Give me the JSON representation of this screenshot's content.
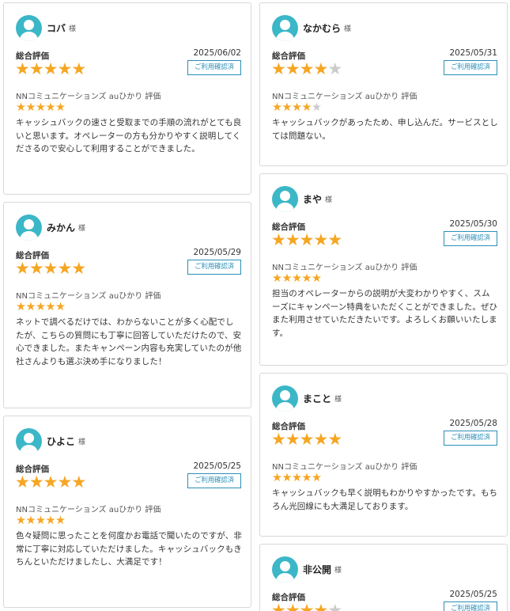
{
  "colors": {
    "star": "#f5a623",
    "star_empty": "#cccccc",
    "avatar": "#3bb7c7",
    "badge": "#2b8fb8"
  },
  "icons": {
    "star": "★",
    "avatar": "user-avatar-icon"
  },
  "labels": {
    "honorific": "様",
    "overall": "総合評価",
    "verified": "ご利用確認済",
    "service_rating": "NNコミュニケーションズ auひかり 評価"
  },
  "reviews": [
    {
      "name": "コバ",
      "date": "2025/06/02",
      "overall": 5,
      "service": 5,
      "comment": "キャッシュバックの速さと受取までの手順の流れがとても良いと思います。オペレーターの方も分かりやすく説明してくださるので安心して利用することができました。"
    },
    {
      "name": "なかむら",
      "date": "2025/05/31",
      "overall": 4,
      "service": 4,
      "comment": "キャッシュバックがあったため、申し込んだ。サービスとしては問題ない。"
    },
    {
      "name": "みかん",
      "date": "2025/05/29",
      "overall": 5,
      "service": 5,
      "comment": "ネットで調べるだけでは、わからないことが多く心配でしたが、こちらの質問にも丁寧に回答していただけたので、安心できました。またキャンペーン内容も充実していたのが他社さんよりも選ぶ決め手になりました！"
    },
    {
      "name": "まや",
      "date": "2025/05/30",
      "overall": 5,
      "service": 5,
      "comment": "担当のオペレーターからの説明が大変わかりやすく、スムーズにキャンペーン特典をいただくことができました。ぜひまた利用させていただきたいです。よろしくお願いいたします。"
    },
    {
      "name": "ひよこ",
      "date": "2025/05/25",
      "overall": 5,
      "service": 5,
      "comment": "色々疑問に思ったことを何度かお電話で聞いたのですが、非常に丁寧に対応していただけました。キャッシュバックもきちんといただけましたし、大満足です！"
    },
    {
      "name": "まこと",
      "date": "2025/05/28",
      "overall": 5,
      "service": 5,
      "comment": "キャッシュバックも早く説明もわかりやすかったです。もちろん光回線にも大満足しております。"
    },
    {
      "name": "非公開",
      "date": "2025/05/25",
      "overall": 4,
      "service": null,
      "comment": ""
    }
  ]
}
